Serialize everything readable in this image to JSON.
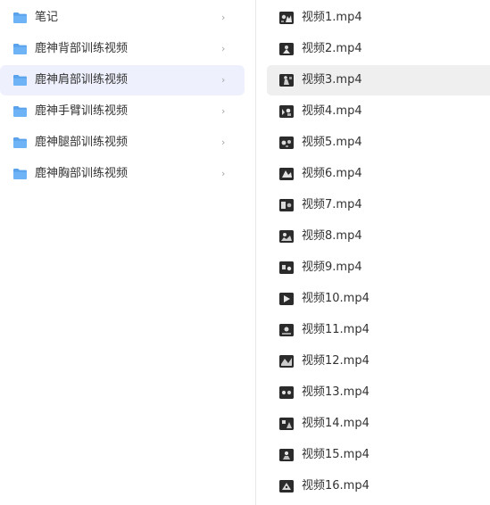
{
  "folders": [
    {
      "label": "笔记",
      "selected": false
    },
    {
      "label": "鹿神背部训练视频",
      "selected": false
    },
    {
      "label": "鹿神肩部训练视频",
      "selected": true
    },
    {
      "label": "鹿神手臂训练视频",
      "selected": false
    },
    {
      "label": "鹿神腿部训练视频",
      "selected": false
    },
    {
      "label": "鹿神胸部训练视频",
      "selected": false
    }
  ],
  "chevron_glyph": "›",
  "files": [
    {
      "label": "视频1.mp4",
      "selected": false
    },
    {
      "label": "视频2.mp4",
      "selected": false
    },
    {
      "label": "视频3.mp4",
      "selected": true
    },
    {
      "label": "视频4.mp4",
      "selected": false
    },
    {
      "label": "视频5.mp4",
      "selected": false
    },
    {
      "label": "视频6.mp4",
      "selected": false
    },
    {
      "label": "视频7.mp4",
      "selected": false
    },
    {
      "label": "视频8.mp4",
      "selected": false
    },
    {
      "label": "视频9.mp4",
      "selected": false
    },
    {
      "label": "视频10.mp4",
      "selected": false
    },
    {
      "label": "视频11.mp4",
      "selected": false
    },
    {
      "label": "视频12.mp4",
      "selected": false
    },
    {
      "label": "视频13.mp4",
      "selected": false
    },
    {
      "label": "视频14.mp4",
      "selected": false
    },
    {
      "label": "视频15.mp4",
      "selected": false
    },
    {
      "label": "视频16.mp4",
      "selected": false
    }
  ],
  "colors": {
    "folder_icon": "#5aa2ec",
    "selected_folder_bg": "#eef1fd",
    "selected_file_bg": "#efefef",
    "thumbnail_dark": "#2b2b2b"
  },
  "icons": {
    "folder": "folder-icon",
    "chevron": "chevron-right-icon",
    "thumbnail": "video-thumbnail-icon"
  }
}
